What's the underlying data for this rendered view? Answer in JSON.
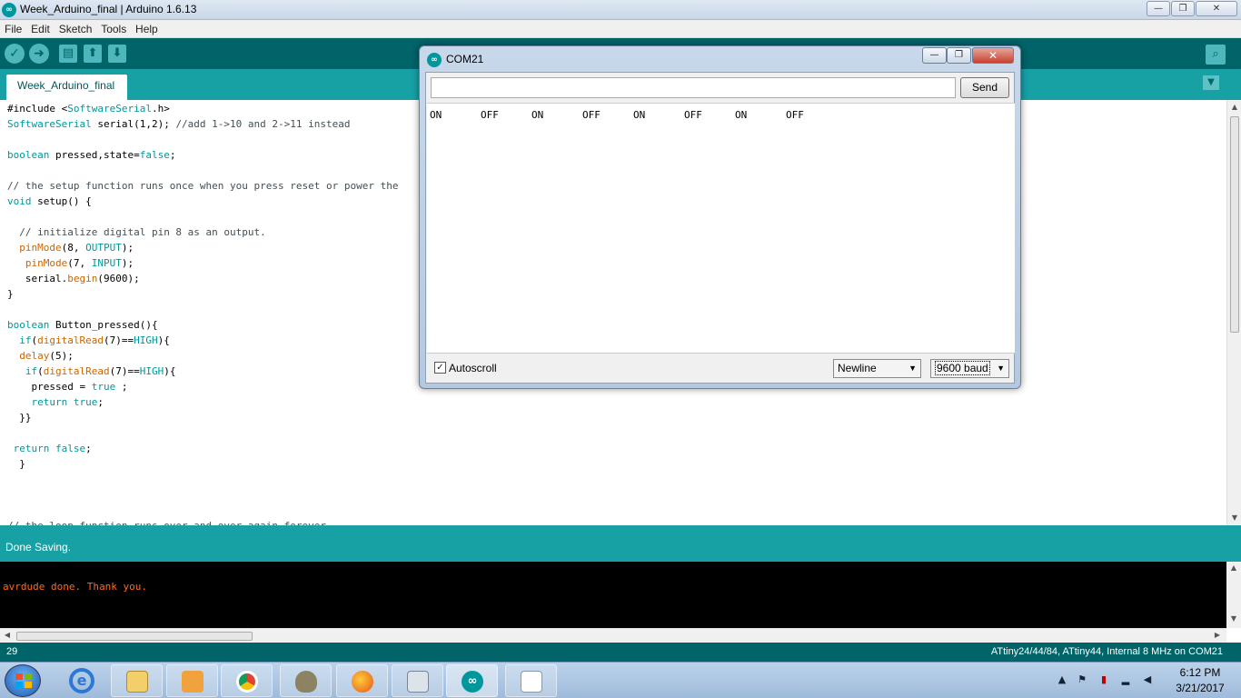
{
  "window": {
    "title": "Week_Arduino_final | Arduino 1.6.13",
    "minimize": "—",
    "maximize": "❐",
    "close": "✕"
  },
  "menu": [
    "File",
    "Edit",
    "Sketch",
    "Tools",
    "Help"
  ],
  "toolbar": {
    "verify_icon": "check-icon",
    "upload_icon": "arrow-right-icon",
    "new_icon": "new-file-icon",
    "open_icon": "open-up-icon",
    "save_icon": "save-down-icon",
    "serial_monitor_icon": "magnifier-icon"
  },
  "tabs": {
    "active": "Week_Arduino_final",
    "menu_glyph": "▼"
  },
  "editor": {
    "code_lines": [
      "#include <SoftwareSerial.h>",
      "SoftwareSerial serial(1,2); //add 1->10 and 2->11 instead",
      "",
      "boolean pressed,state=false;",
      "",
      "// the setup function runs once when you press reset or power the",
      "void setup() {",
      "",
      "  // initialize digital pin 8 as an output.",
      "  pinMode(8, OUTPUT);",
      "   pinMode(7, INPUT);",
      "   serial.begin(9600);",
      "}",
      "",
      "boolean Button_pressed(){",
      "  if(digitalRead(7)==HIGH){",
      "  delay(5);",
      "   if(digitalRead(7)==HIGH){",
      "    pressed = true ;",
      "    return true;",
      "  }}",
      "",
      " return false;",
      "  }",
      "",
      "",
      "",
      "// the loop function runs over and over again forever"
    ]
  },
  "status": {
    "message": "Done Saving."
  },
  "console": {
    "line": "avrdude done.  Thank you."
  },
  "board_bar": {
    "line_number": "29",
    "board": "ATtiny24/44/84, ATtiny44, Internal 8 MHz on COM21"
  },
  "serial_monitor": {
    "title": "COM21",
    "input_value": "",
    "send_label": "Send",
    "output": [
      "ON",
      "OFF",
      "ON",
      "OFF",
      "ON",
      "OFF",
      "ON",
      "OFF"
    ],
    "autoscroll_label": "Autoscroll",
    "autoscroll_checked": true,
    "line_ending": "Newline",
    "baud": "9600 baud"
  },
  "taskbar": {
    "apps": [
      "internet-explorer-icon",
      "file-explorer-icon",
      "media-player-icon",
      "chrome-icon",
      "gimp-icon",
      "firefox-icon",
      "calculator-icon",
      "arduino-icon",
      "notepad-icon"
    ],
    "time": "6:12 PM",
    "date": "3/21/2017"
  },
  "colors": {
    "arduino_teal": "#00979c",
    "toolbar_dark": "#006468",
    "tab_bar": "#17a1a5",
    "console_text": "#ff6a1a"
  }
}
